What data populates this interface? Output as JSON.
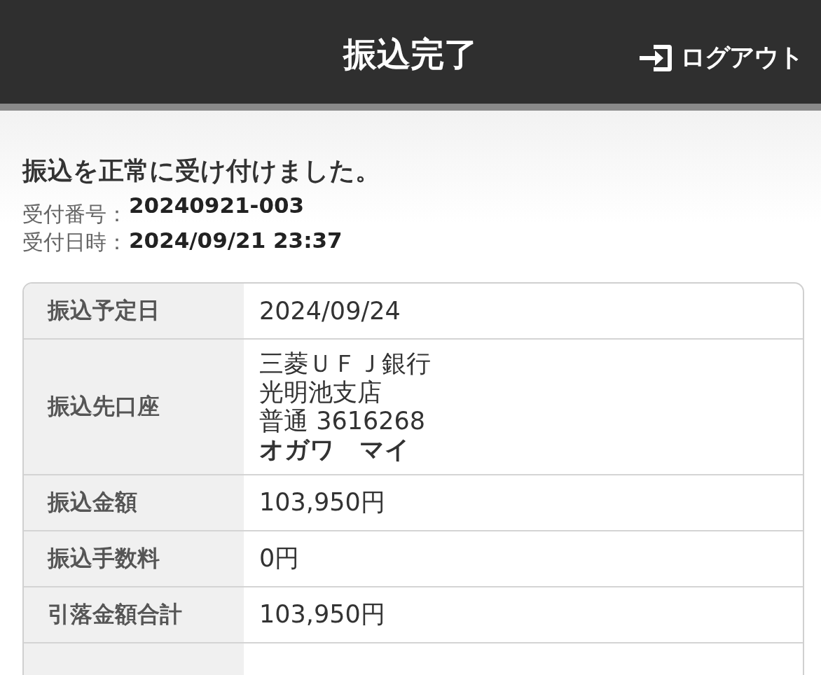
{
  "header": {
    "title": "振込完了",
    "logout_label": "ログアウト"
  },
  "message": "振込を正常に受け付けました。",
  "receipt": [
    {
      "label": "受付番号：",
      "value": "20240921-003"
    },
    {
      "label": "受付日時：",
      "value": "2024/09/21 23:37"
    }
  ],
  "details": [
    {
      "label": "振込予定日",
      "lines": [
        {
          "text": "2024/09/24",
          "bold": false
        }
      ]
    },
    {
      "label": "振込先口座",
      "lines": [
        {
          "text": "三菱ＵＦＪ銀行",
          "bold": false
        },
        {
          "text": "光明池支店",
          "bold": false
        },
        {
          "text": "普通 3616268",
          "bold": false
        },
        {
          "text": "オガワ　マイ",
          "bold": true
        }
      ]
    },
    {
      "label": "振込金額",
      "lines": [
        {
          "text": "103,950円",
          "bold": false
        }
      ]
    },
    {
      "label": "振込手数料",
      "lines": [
        {
          "text": "0円",
          "bold": false
        }
      ]
    },
    {
      "label": "引落金額合計",
      "lines": [
        {
          "text": "103,950円",
          "bold": false
        }
      ]
    }
  ]
}
